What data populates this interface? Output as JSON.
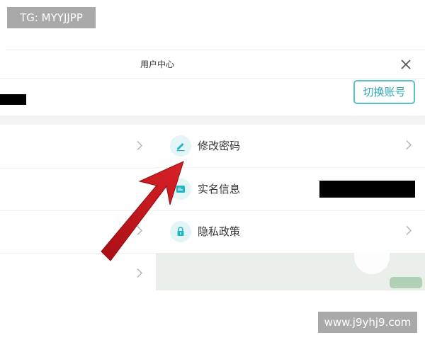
{
  "watermarks": {
    "top_left": "TG: MYYJJPP",
    "bottom_right": "www.j9yhj9.com"
  },
  "header": {
    "title": "用户中心",
    "close_icon": "close-icon"
  },
  "account": {
    "switch_label": "切换账号"
  },
  "menu": [
    {
      "label": "修改密码",
      "icon": "pencil-icon"
    },
    {
      "label": "实名信息",
      "icon": "id-card-icon"
    },
    {
      "label": "隐私政策",
      "icon": "lock-icon"
    }
  ],
  "colors": {
    "accent": "#2fa7b0",
    "accent_border": "#59c2c9",
    "icon": "#1fb6c9",
    "annotation_arrow": "#c0161c"
  }
}
